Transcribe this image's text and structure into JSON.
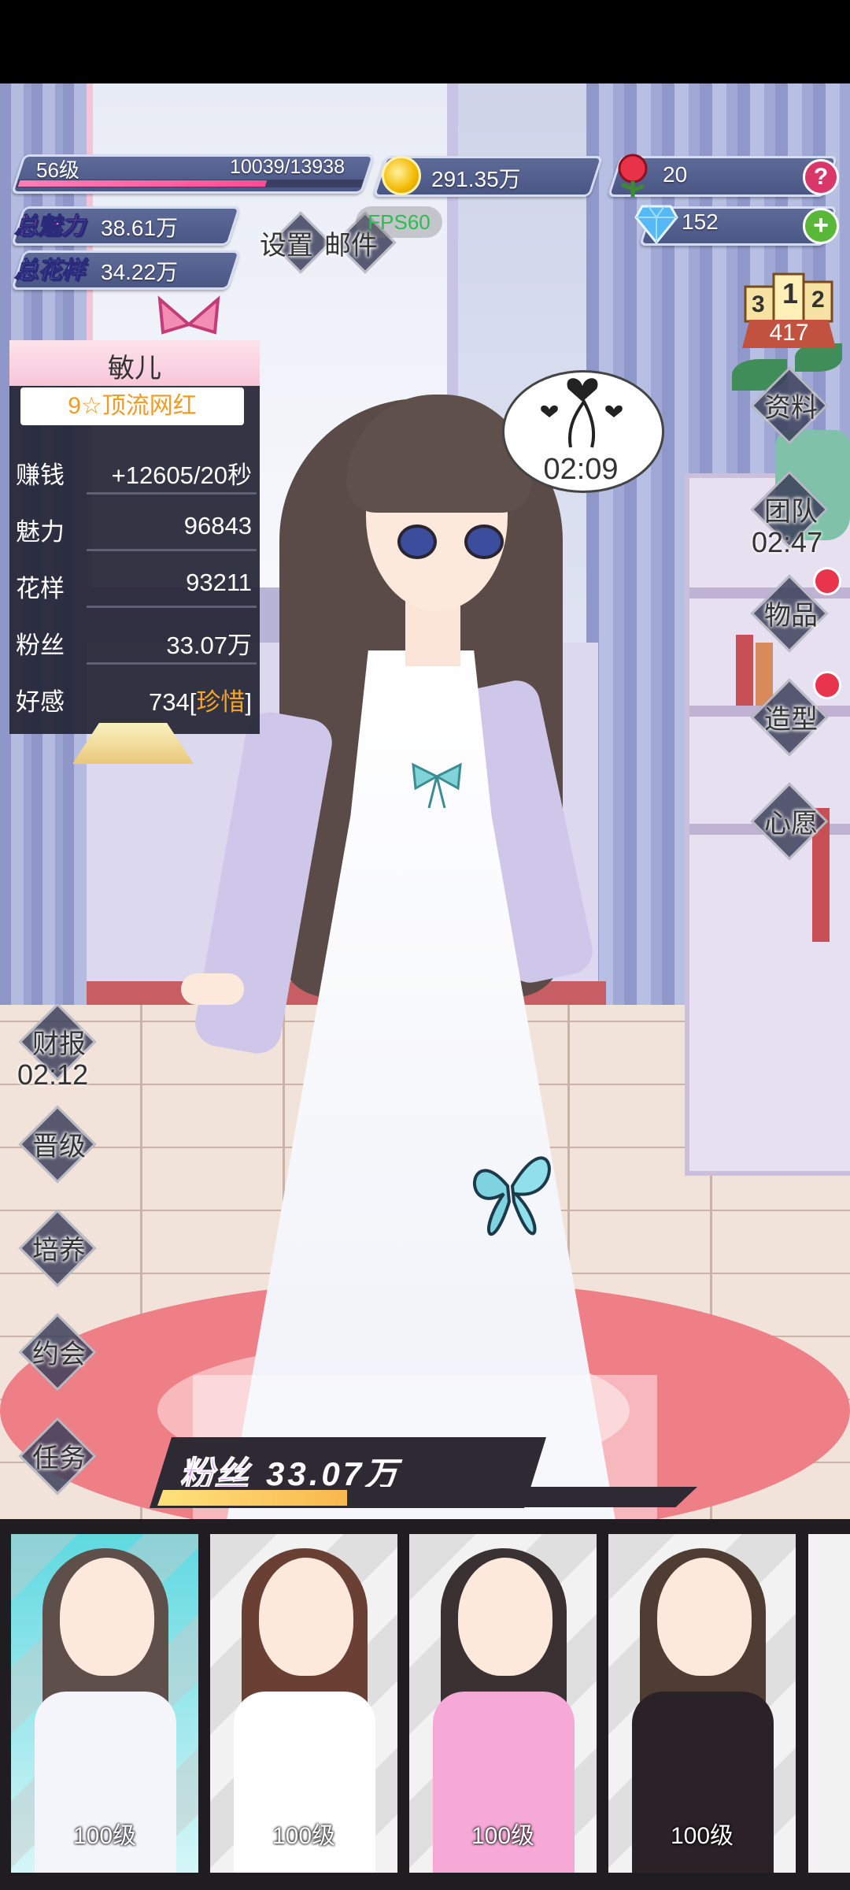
{
  "player": {
    "level_label": "56级",
    "xp_text": "10039/13938",
    "xp_progress": 0.72
  },
  "currency": {
    "coins": "291.35万",
    "roses": "20",
    "diamonds": "152"
  },
  "stats": {
    "charm_label": "总魅力",
    "charm_value": "38.61万",
    "style_label": "总花样",
    "style_value": "34.22万"
  },
  "top_menu": {
    "settings_label": "设置",
    "mail_label": "邮件",
    "fps_text": "FPS60"
  },
  "ranking": {
    "podium_digits": [
      "3",
      "1",
      "2"
    ],
    "value": "417"
  },
  "character": {
    "name": "敏儿",
    "rank_title": "9☆顶流网红",
    "rows": [
      {
        "key": "赚钱",
        "value": "+12605/20秒"
      },
      {
        "key": "魅力",
        "value": "96843"
      },
      {
        "key": "花样",
        "value": "93211"
      },
      {
        "key": "粉丝",
        "value": "33.07万"
      }
    ],
    "affection_key": "好感",
    "affection_value": "734",
    "affection_bracket_open": "[",
    "affection_tag": "珍惜",
    "affection_bracket_close": "]"
  },
  "bubble": {
    "timer": "02:09"
  },
  "right_menu": {
    "profile": "资料",
    "team": "团队",
    "team_timer": "02:47",
    "items": "物品",
    "styling": "造型",
    "wish": "心愿"
  },
  "left_menu": {
    "report": "财报",
    "report_timer": "02:12",
    "promote": "晋级",
    "train": "培养",
    "date": "约会",
    "tasks": "任务"
  },
  "fans_bar": {
    "label": "粉丝",
    "value": "33.07万",
    "progress": 0.35
  },
  "roster": [
    {
      "level": "100级",
      "hair": "#5e4f4b",
      "outfit": "#f4f4fb",
      "selected": true
    },
    {
      "level": "100级",
      "hair": "#6b4034",
      "outfit": "#ffffff",
      "selected": false
    },
    {
      "level": "100级",
      "hair": "#3a3232",
      "outfit": "#f6a8d6",
      "selected": false
    },
    {
      "level": "100级",
      "hair": "#4f3d33",
      "outfit": "#2a2226",
      "selected": false
    }
  ],
  "colors": {
    "accent_pink": "#ff4d94",
    "gold": "#f6a623",
    "notification": "#e8344c",
    "help": "#d9366a",
    "add": "#59b838"
  },
  "icons": [
    "coin-icon",
    "rose-icon",
    "diamond-icon",
    "help-icon",
    "plus-icon",
    "podium-icon",
    "heart-icon",
    "butterfly-icon"
  ]
}
